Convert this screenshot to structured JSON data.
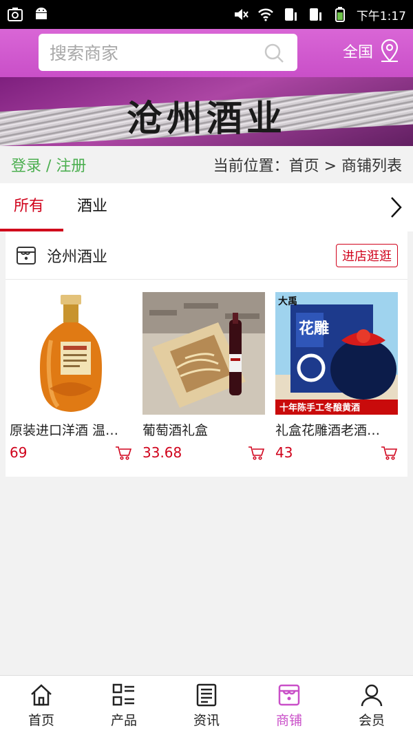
{
  "status_bar": {
    "time": "下午1:17"
  },
  "header": {
    "search_placeholder": "搜索商家",
    "region_label": "全国"
  },
  "banner": {
    "title": "沧州酒业"
  },
  "breadcrumb": {
    "login_register": "登录 / 注册",
    "location": "当前位置：首页 > 商铺列表"
  },
  "tabs": [
    {
      "label": "所有",
      "active": true
    },
    {
      "label": "酒业",
      "active": false
    }
  ],
  "shop": {
    "name": "沧州酒业",
    "enter_label": "进店逛逛",
    "products": [
      {
        "name": "原装进口洋酒 温…",
        "price": "69"
      },
      {
        "name": "葡萄酒礼盒",
        "price": "33.68"
      },
      {
        "name": "礼盒花雕酒老酒…",
        "price": "43"
      }
    ]
  },
  "product_image_text": {
    "p3_banner": "十年陈手工冬酿黄酒",
    "p3_label": "花雕",
    "p3_corner": "大禹"
  },
  "bottom_nav": [
    {
      "label": "首页",
      "icon": "home-icon",
      "active": false
    },
    {
      "label": "产品",
      "icon": "grid-list-icon",
      "active": false
    },
    {
      "label": "资讯",
      "icon": "news-icon",
      "active": false
    },
    {
      "label": "商铺",
      "icon": "shop-icon",
      "active": true
    },
    {
      "label": "会员",
      "icon": "user-icon",
      "active": false
    }
  ],
  "colors": {
    "accent": "#c94fc8",
    "price_red": "#d0021b",
    "login_green": "#4caf50"
  }
}
